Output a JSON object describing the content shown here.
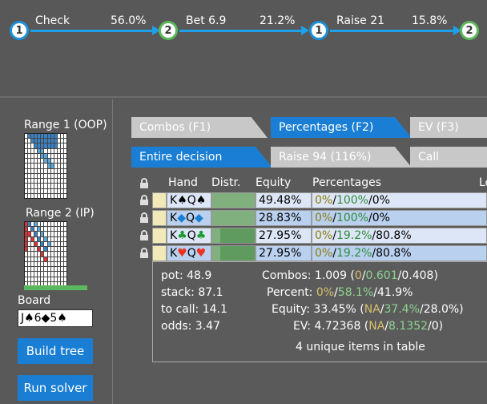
{
  "tree": {
    "nodes": [
      {
        "label": "1",
        "player": "oop"
      },
      {
        "label": "2",
        "player": "ip"
      },
      {
        "label": "1",
        "player": "oop"
      },
      {
        "label": "2",
        "player": "ip"
      }
    ],
    "edges": [
      {
        "action": "Check",
        "pct": "56.0%"
      },
      {
        "action": "Bet 6.9",
        "pct": "21.2%"
      },
      {
        "action": "Raise 21",
        "pct": "15.8%"
      }
    ]
  },
  "left": {
    "range1_label": "Range 1 (OOP)",
    "range2_label": "Range 2 (IP)",
    "board_label": "Board",
    "board_value": "J♠6◆5♠",
    "build_tree": "Build tree",
    "run_solver": "Run solver"
  },
  "tabs": {
    "top": [
      "Combos (F1)",
      "Percentages (F2)",
      "EV (F3)"
    ],
    "top_active": "Percentages (F2)",
    "sub": [
      "Entire decision",
      "Raise 94 (116%)",
      "Call"
    ],
    "sub_active": "Entire decision"
  },
  "table": {
    "headers": [
      "Hand",
      "Distr.",
      "Equity",
      "Percentages",
      "Lo"
    ],
    "rows": [
      {
        "hand_rank1": "K",
        "suit1": "♠",
        "hand_rank2": "Q",
        "suit2": "♠",
        "equity": "49.48%",
        "p1": "0%",
        "p2": "100%",
        "p3": "0%"
      },
      {
        "hand_rank1": "K",
        "suit1": "◆",
        "hand_rank2": "Q",
        "suit2": "◆",
        "equity": "28.83%",
        "p1": "0%",
        "p2": "100%",
        "p3": "0%"
      },
      {
        "hand_rank1": "K",
        "suit1": "♣",
        "hand_rank2": "Q",
        "suit2": "♣",
        "equity": "27.95%",
        "p1": "0%",
        "p2": "19.2%",
        "p3": "80.8%"
      },
      {
        "hand_rank1": "K",
        "suit1": "♥",
        "hand_rank2": "Q",
        "suit2": "♥",
        "equity": "27.95%",
        "p1": "0%",
        "p2": "19.2%",
        "p3": "80.8%"
      }
    ]
  },
  "summary": {
    "pot": "pot: 48.9",
    "stack": "stack: 87.1",
    "to_call": "to call: 14.1",
    "odds": "odds: 3.47",
    "combos_label": "Combos:",
    "combos_a": "1.009 (",
    "combos_b": "0",
    "combos_c": "0.601",
    "combos_d": "0.408)",
    "percent_label": "Percent:",
    "percent_a": "0%",
    "percent_b": "58.1%",
    "percent_c": "41.9%",
    "equity_label": "Equity:",
    "equity_a": "33.45% (",
    "equity_b": "NA",
    "equity_c": "37.4%",
    "equity_d": "28.0%)",
    "ev_label": "EV:",
    "ev_a": "4.72368 (",
    "ev_b": "NA",
    "ev_c": "8.1352",
    "ev_d": "0)",
    "unique": "4 unique items in table"
  }
}
